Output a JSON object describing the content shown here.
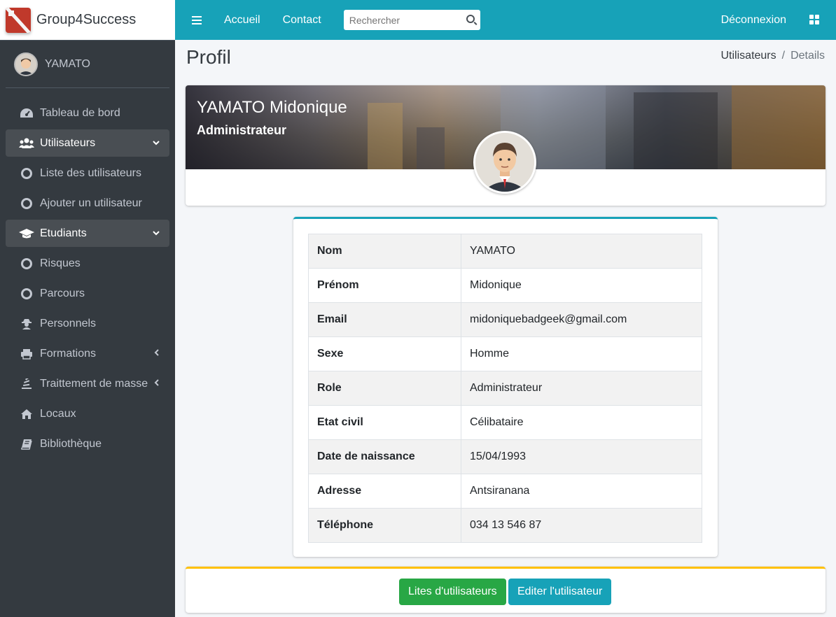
{
  "brand": {
    "name": "Group4Success"
  },
  "user": {
    "name": "YAMATO"
  },
  "sidebar": {
    "items": [
      {
        "label": "Tableau de bord",
        "icon": "dashboard-icon"
      },
      {
        "label": "Utilisateurs",
        "icon": "users-icon",
        "active": true
      },
      {
        "label": "Liste des utilisateurs",
        "icon": "circle-icon"
      },
      {
        "label": "Ajouter un utilisateur",
        "icon": "circle-icon"
      },
      {
        "label": "Etudiants",
        "icon": "graduation-cap-icon",
        "active": true
      },
      {
        "label": "Risques",
        "icon": "circle-icon"
      },
      {
        "label": "Parcours",
        "icon": "circle-icon"
      },
      {
        "label": "Personnels",
        "icon": "user-secret-icon"
      },
      {
        "label": "Formations",
        "icon": "print-icon"
      },
      {
        "label": "Traittement de masse",
        "icon": "stack-icon"
      },
      {
        "label": "Locaux",
        "icon": "home-icon"
      },
      {
        "label": "Bibliothèque",
        "icon": "book-icon"
      }
    ]
  },
  "topbar": {
    "home": "Accueil",
    "contact": "Contact",
    "search_placeholder": "Rechercher",
    "logout": "Déconnexion"
  },
  "page": {
    "title": "Profil",
    "breadcrumb": [
      "Utilisateurs",
      "Details"
    ]
  },
  "profile": {
    "full_name": "YAMATO Midonique",
    "role": "Administrateur"
  },
  "details": [
    {
      "key": "Nom",
      "value": "YAMATO"
    },
    {
      "key": "Prénom",
      "value": "Midonique"
    },
    {
      "key": "Email",
      "value": "midoniquebadgeek@gmail.com"
    },
    {
      "key": "Sexe",
      "value": "Homme"
    },
    {
      "key": "Role",
      "value": "Administrateur"
    },
    {
      "key": "Etat civil",
      "value": "Célibataire"
    },
    {
      "key": "Date de naissance",
      "value": "15/04/1993"
    },
    {
      "key": "Adresse",
      "value": "Antsiranana"
    },
    {
      "key": "Téléphone",
      "value": "034 13 546 87"
    }
  ],
  "actions": {
    "list_users": "Lites d'utilisateurs",
    "edit_user": "Editer l'utilisateur"
  },
  "colors": {
    "topbar": "#17a2b8",
    "sidebar": "#343a40",
    "success": "#28a745",
    "warning": "#ffc107"
  }
}
